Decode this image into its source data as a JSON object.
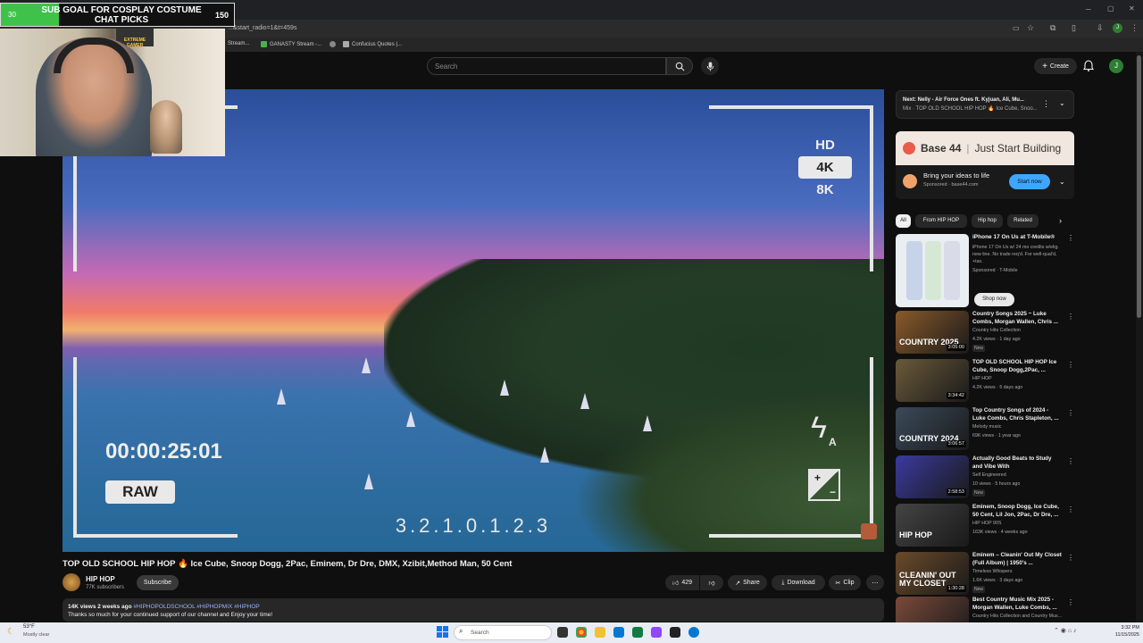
{
  "browser": {
    "address": "...&start_radio=1&t=459s",
    "bookmarks": [
      "Stream...",
      "GANASTY Stream -...",
      "Confucius Quotes |..."
    ]
  },
  "overlay": {
    "goal_start": "30",
    "goal_title": "SUB GOAL FOR COSPLAY COSTUME CHAT PICKS",
    "goal_end": "150",
    "goal_progress": 0.25,
    "poster_text": "EXTREME GAMER"
  },
  "header": {
    "search_placeholder": "Search",
    "create_label": "Create",
    "avatar_letter": "J"
  },
  "video": {
    "quality_options": [
      "HD",
      "4K",
      "8K"
    ],
    "quality_selected": "4K",
    "timecode": "00:00:25:01",
    "raw_label": "RAW",
    "meter": "3.2.1.0.1.2.3",
    "flash_mode": "A",
    "exposure_plus": "+",
    "exposure_minus": "−"
  },
  "info": {
    "title": "TOP OLD SCHOOL HIP HOP 🔥 Ice Cube, Snoop Dogg, 2Pac, Eminem, Dr Dre, DMX, Xzibit,Method Man, 50 Cent",
    "channel": "HIP HOP",
    "subscribers": "77K subscribers",
    "subscribe_label": "Subscribe",
    "likes": "429",
    "share_label": "Share",
    "download_label": "Download",
    "clip_label": "Clip",
    "views_date": "14K views  2 weeks ago",
    "hashtags": "#HIPHOPOLDSCHOOL #HIPHOPMIX #HIPHOP",
    "description": "Thanks so much for your continued support of our channel and Enjoy your time!"
  },
  "sidebar": {
    "next_line1": "Next: Nelly - Air Force Ones ft. Kyjuan, Ali, Mu...",
    "next_line2": "Mix · TOP OLD SCHOOL HIP HOP 🔥 Ice Cube, Snoo...",
    "ad": {
      "brand": "Base 44",
      "tagline": "Just Start Building",
      "headline": "Bring your ideas to life",
      "sponsor": "Sponsored · base44.com",
      "cta": "Start now"
    },
    "chips": [
      "All",
      "From HIP HOP",
      "Hip hop",
      "Related"
    ],
    "phone_ad": {
      "title": "iPhone 17 On Us at T-Mobile®",
      "body": "iPhone 17 On Us w/ 24 mo credits w/elig. new line. No trade req'd. For well-qual'd, +tax.",
      "sponsor": "Sponsored · T-Mobile",
      "cta": "Shop now"
    },
    "recs": [
      {
        "title": "Country Songs 2025 ~ Luke Combs, Morgan Wallen, Chris ...",
        "channel": "Country Hits Collection",
        "meta": "4.2K views · 1 day ago",
        "badge": "New",
        "duration": "3:05:00",
        "thumb_text": "COUNTRY 2025",
        "color": "#8a5a2a"
      },
      {
        "title": "TOP OLD SCHOOL HIP HOP Ice Cube, Snoop Dogg,2Pac, ...",
        "channel": "HIP HOP",
        "meta": "4.2K views · 5 days ago",
        "badge": "",
        "duration": "3:34:42",
        "thumb_text": "",
        "color": "#6a5a3a"
      },
      {
        "title": "Top Country Songs of 2024 - Luke Combs, Chris Stapleton, ...",
        "channel": "Melody music",
        "meta": "69K views · 1 year ago",
        "badge": "",
        "duration": "3:06:57",
        "thumb_text": "COUNTRY 2024",
        "color": "#3a4a5a"
      },
      {
        "title": "Actually Good Beats to Study and Vibe With",
        "channel": "Self Engineered",
        "meta": "10 views · 5 hours ago",
        "badge": "New",
        "duration": "2:58:53",
        "thumb_text": "",
        "color": "#3a3aa0"
      },
      {
        "title": "Eminem, Snoop Dogg, Ice Cube, 50 Cent, Lil Jon, 2Pac, Dr Dre, ...",
        "channel": "HIP HOP 90S",
        "meta": "163K views · 4 weeks ago",
        "badge": "",
        "duration": "",
        "thumb_text": "HIP HOP",
        "color": "#444"
      },
      {
        "title": "Eminem – Cleanin' Out My Closet (Full Album) | 1950's ...",
        "channel": "Timeless Whispers",
        "meta": "1.6K views · 3 days ago",
        "badge": "New",
        "duration": "1:30:28",
        "thumb_text": "CLEANIN' OUT MY CLOSET",
        "color": "#6a4a2a"
      },
      {
        "title": "Best Country Music Mix 2025 - Morgan Wallen, Luke Combs, ...",
        "channel": "Country Hits Collection and Country Mus...",
        "meta": "",
        "badge": "",
        "duration": "",
        "thumb_text": "NEW COUNTRY",
        "color": "#7a4a3a"
      }
    ]
  },
  "taskbar": {
    "temp": "53°F",
    "condition": "Mostly clear",
    "search": "Search",
    "time": "3:32 PM",
    "date": "11/15/2025"
  },
  "colors": {
    "accent_blue": "#3ea6ff",
    "goal_green": "#3fc24a",
    "avatar_green": "#2e7d32"
  }
}
